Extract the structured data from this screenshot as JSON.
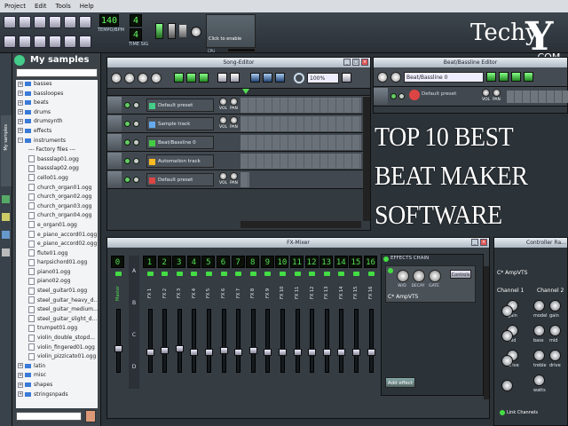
{
  "menu": [
    "Project",
    "Edit",
    "Tools",
    "Help"
  ],
  "toolbar": {
    "tempo_value": "140",
    "tempo_label": "TEMPO/BPM",
    "timesig_num": "4",
    "timesig_den": "4",
    "timesig_label": "TIME SIG",
    "cpu_hint": "Click to enable",
    "cpu_label": "CPU"
  },
  "logo": {
    "text": "Techy",
    "domain": ".COM"
  },
  "browser": {
    "title": "My samples",
    "side_tabs": [
      "My samples"
    ],
    "tree": [
      {
        "label": "basses",
        "kind": "folder",
        "depth": 0
      },
      {
        "label": "bassloopes",
        "kind": "folder",
        "depth": 0
      },
      {
        "label": "beats",
        "kind": "folder",
        "depth": 0
      },
      {
        "label": "drums",
        "kind": "folder",
        "depth": 0
      },
      {
        "label": "drumsynth",
        "kind": "folder",
        "depth": 0
      },
      {
        "label": "effects",
        "kind": "folder",
        "depth": 0
      },
      {
        "label": "instruments",
        "kind": "folder",
        "depth": 0
      },
      {
        "label": "--- Factory files ---",
        "kind": "sep",
        "depth": 1
      },
      {
        "label": "bassslap01.ogg",
        "kind": "file",
        "depth": 1
      },
      {
        "label": "bassslap02.ogg",
        "kind": "file",
        "depth": 1
      },
      {
        "label": "cello01.ogg",
        "kind": "file",
        "depth": 1
      },
      {
        "label": "church_organ01.ogg",
        "kind": "file",
        "depth": 1
      },
      {
        "label": "church_organ02.ogg",
        "kind": "file",
        "depth": 1
      },
      {
        "label": "church_organ03.ogg",
        "kind": "file",
        "depth": 1
      },
      {
        "label": "church_organ04.ogg",
        "kind": "file",
        "depth": 1
      },
      {
        "label": "e_organ01.ogg",
        "kind": "file",
        "depth": 1
      },
      {
        "label": "e_piano_accord01.ogg",
        "kind": "file",
        "depth": 1
      },
      {
        "label": "e_piano_accord02.ogg",
        "kind": "file",
        "depth": 1
      },
      {
        "label": "flute01.ogg",
        "kind": "file",
        "depth": 1
      },
      {
        "label": "harpsichord01.ogg",
        "kind": "file",
        "depth": 1
      },
      {
        "label": "piano01.ogg",
        "kind": "file",
        "depth": 1
      },
      {
        "label": "piano02.ogg",
        "kind": "file",
        "depth": 1
      },
      {
        "label": "steel_guitar01.ogg",
        "kind": "file",
        "depth": 1
      },
      {
        "label": "steel_guitar_heavy_d...",
        "kind": "file",
        "depth": 1
      },
      {
        "label": "steel_guitar_medium...",
        "kind": "file",
        "depth": 1
      },
      {
        "label": "steel_guitar_slight_d...",
        "kind": "file",
        "depth": 1
      },
      {
        "label": "trumpet01.ogg",
        "kind": "file",
        "depth": 1
      },
      {
        "label": "violin_double_stopd...",
        "kind": "file",
        "depth": 1
      },
      {
        "label": "violin_fingered01.ogg",
        "kind": "file",
        "depth": 1
      },
      {
        "label": "violin_pizzicato01.ogg",
        "kind": "file",
        "depth": 1
      },
      {
        "label": "latin",
        "kind": "folder",
        "depth": 0
      },
      {
        "label": "misc",
        "kind": "folder",
        "depth": 0
      },
      {
        "label": "shapes",
        "kind": "folder",
        "depth": 0
      },
      {
        "label": "stringsnpads",
        "kind": "folder",
        "depth": 0
      }
    ]
  },
  "song_editor": {
    "title": "Song-Editor",
    "zoom": "100%",
    "tracks": [
      {
        "name": "Default preset",
        "knobs": true,
        "icon": "synth"
      },
      {
        "name": "Sample track",
        "knobs": true,
        "icon": "sample"
      },
      {
        "name": "Beat/Bassline 0",
        "knobs": false,
        "icon": "beat"
      },
      {
        "name": "Automation track",
        "knobs": false,
        "icon": "auto"
      },
      {
        "name": "Default preset",
        "knobs": true,
        "icon": "synth2"
      }
    ],
    "vol_label": "VOL",
    "pan_label": "PAN"
  },
  "bb_editor": {
    "title": "Beat/Bassline Editor",
    "selector": "Beat/Bassline 0",
    "track_name": "Default preset"
  },
  "overlay": {
    "lines": [
      "TOP 10 BEST",
      "BEAT MAKER",
      "SOFTWARE"
    ],
    "color": "#ffffff"
  },
  "fx_mixer": {
    "title": "FX-Mixer",
    "master_num": "0",
    "master_label": "Master",
    "channels": [
      "1",
      "2",
      "3",
      "4",
      "5",
      "6",
      "7",
      "8",
      "9",
      "10",
      "11",
      "12",
      "13",
      "14",
      "15",
      "16"
    ],
    "channel_labels": [
      "FX 1",
      "FX 2",
      "FX 3",
      "FX 4",
      "FX 5",
      "FX 6",
      "FX 7",
      "FX 8",
      "FX 9",
      "FX 10",
      "FX 11",
      "FX 12",
      "FX 13",
      "FX 14",
      "FX 15",
      "FX 16"
    ],
    "bank_labels": [
      "A",
      "B",
      "C",
      "D"
    ],
    "effects_chain_title": "EFFECTS CHAIN",
    "effect_knobs": [
      "W/D",
      "DECAY",
      "GATE"
    ],
    "controls_btn": "Controls",
    "effect_name": "C* AmpVT5",
    "add_effect": "Add effect"
  },
  "controller_rack": {
    "title": "Controller Ra...",
    "plugin": "C* AmpVTS",
    "channel1": "Channel 1",
    "channel2": "Channel 2",
    "labels1": [
      "model",
      "gain",
      "bass",
      "mid",
      "treble",
      "drive"
    ],
    "labels2": [
      "model",
      "gain",
      "bass",
      "mid",
      "treble",
      "drive",
      "watts"
    ],
    "link": "Link Channels"
  }
}
